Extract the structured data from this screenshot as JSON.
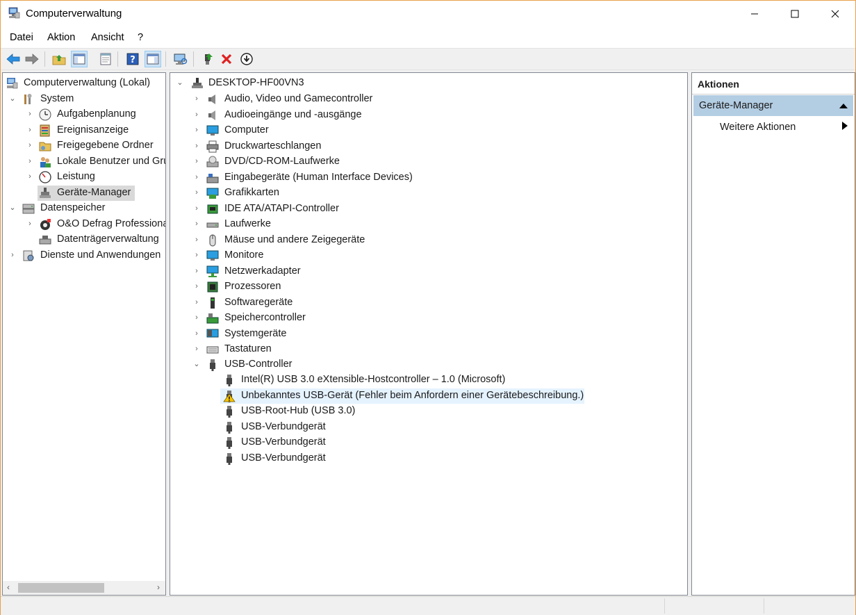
{
  "window": {
    "title": "Computerverwaltung"
  },
  "menu": [
    "Datei",
    "Aktion",
    "Ansicht",
    "?"
  ],
  "toolbar": {
    "buttons": [
      "back-icon",
      "forward-icon",
      "folder-up-icon",
      "console-tree-icon",
      "properties-icon",
      "help-icon",
      "show-pane-icon",
      "scan-hardware-icon",
      "enable-device-icon",
      "uninstall-icon",
      "update-driver-icon"
    ]
  },
  "left_tree": {
    "root": "Computerverwaltung (Lokal)",
    "system": "System",
    "aufgabenplanung": "Aufgabenplanung",
    "ereignisanzeige": "Ereignisanzeige",
    "freigegebene_ordner": "Freigegebene Ordner",
    "lokale_benutzer": "Lokale Benutzer und Gru",
    "leistung": "Leistung",
    "geraete_manager": "Geräte-Manager",
    "datenspeicher": "Datenspeicher",
    "oo_defrag": "O&O Defrag Professiona",
    "datentraeger": "Datenträgerverwaltung",
    "dienste": "Dienste und Anwendungen"
  },
  "device_tree": {
    "computer_name": "DESKTOP-HF00VN3",
    "categories": [
      "Audio, Video und Gamecontroller",
      "Audioeingänge und -ausgänge",
      "Computer",
      "Druckwarteschlangen",
      "DVD/CD-ROM-Laufwerke",
      "Eingabegeräte (Human Interface Devices)",
      "Grafikkarten",
      "IDE ATA/ATAPI-Controller",
      "Laufwerke",
      "Mäuse und andere Zeigegeräte",
      "Monitore",
      "Netzwerkadapter",
      "Prozessoren",
      "Softwaregeräte",
      "Speichercontroller",
      "Systemgeräte",
      "Tastaturen"
    ],
    "usb_category": "USB-Controller",
    "usb_devices": [
      "Intel(R) USB 3.0 eXtensible-Hostcontroller – 1.0 (Microsoft)",
      "Unbekanntes USB-Gerät (Fehler beim Anfordern einer Gerätebeschreibung.)",
      "USB-Root-Hub (USB 3.0)",
      "USB-Verbundgerät",
      "USB-Verbundgerät",
      "USB-Verbundgerät"
    ]
  },
  "actions": {
    "header": "Aktionen",
    "section": "Geräte-Manager",
    "more": "Weitere Aktionen"
  }
}
